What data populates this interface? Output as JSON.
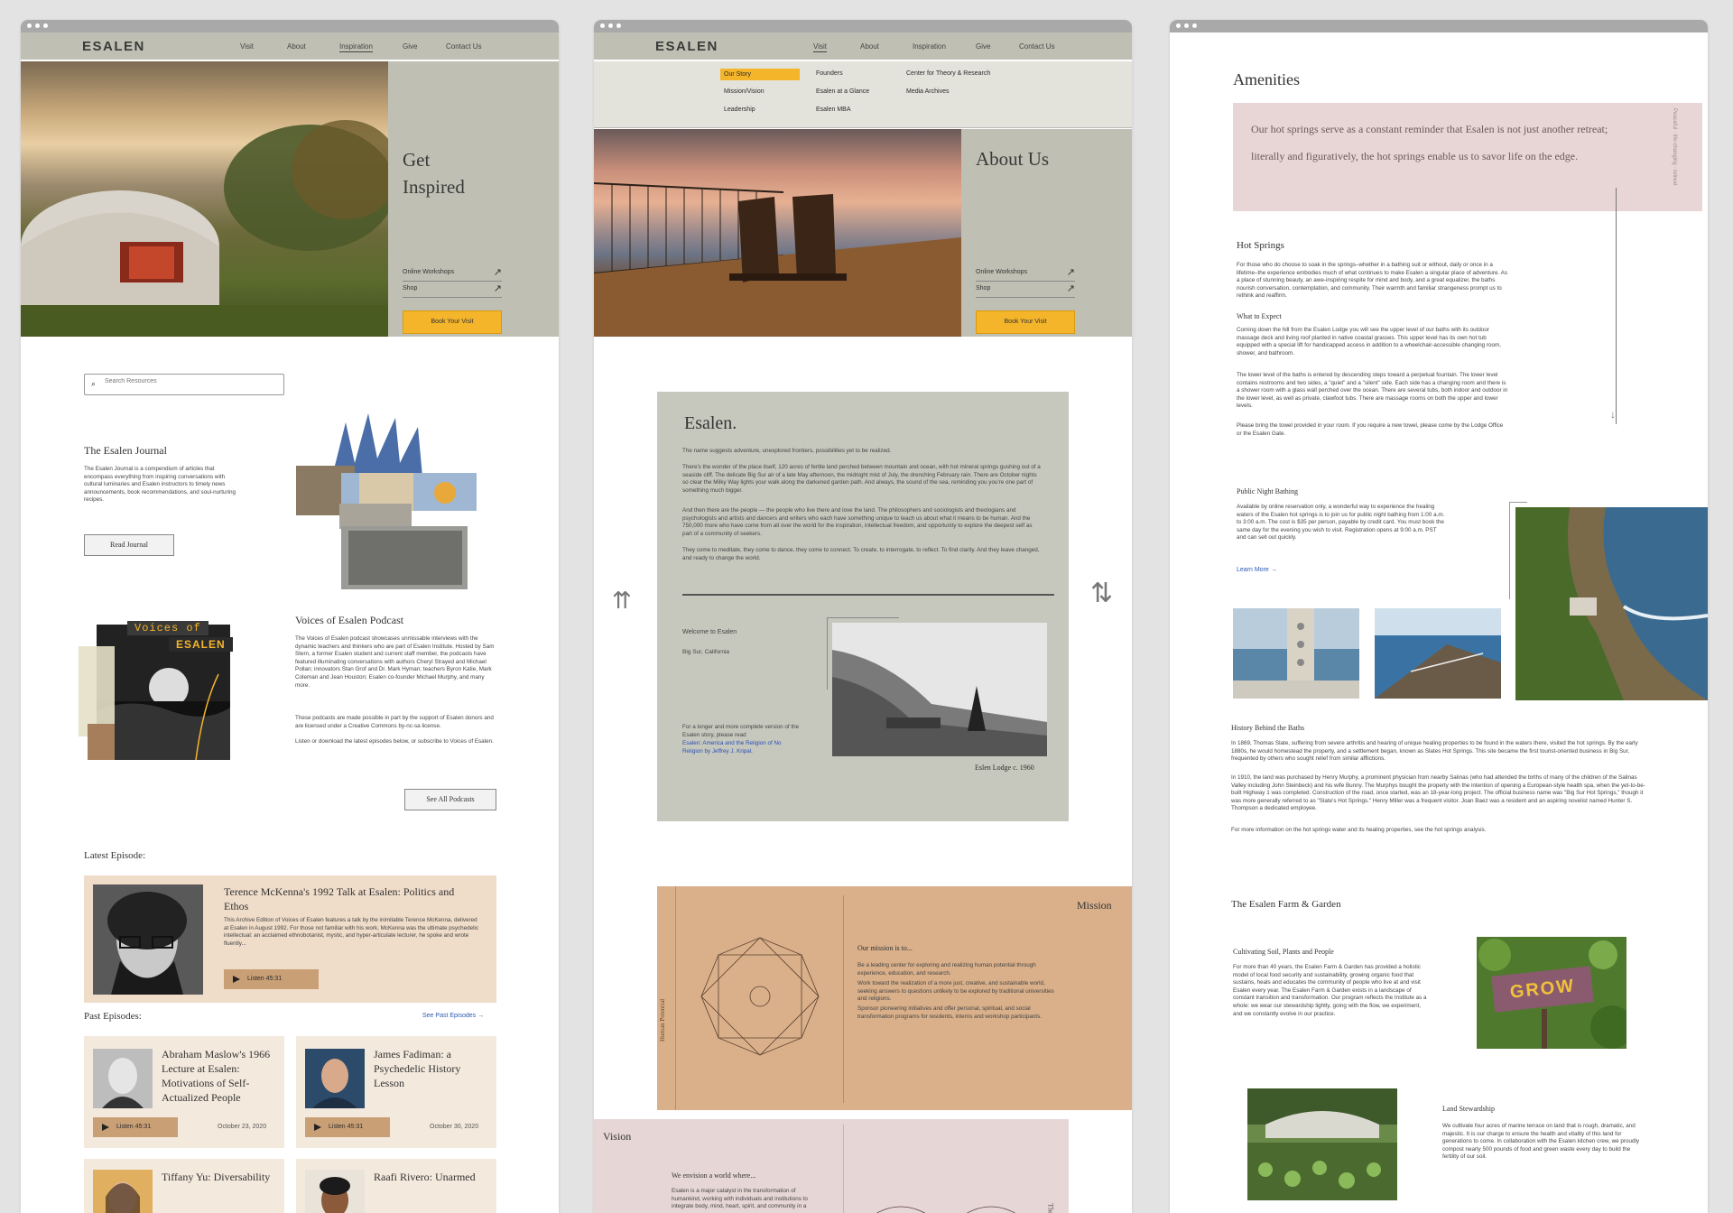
{
  "colors": {
    "background": "#e4e3e4",
    "nav_sage": "#bfc0b3",
    "accent_yellow": "#f5b52b",
    "card_cream": "#f4e9dd",
    "listen_tan": "#c99f76",
    "mission_tan": "#d9b08a",
    "vision_pink": "#e7d6d6",
    "quote_pink": "#e8d5d5"
  },
  "shared": {
    "logo": "ESALEN",
    "nav": [
      "Visit",
      "About",
      "Inspiration",
      "Give",
      "Contact Us"
    ],
    "links": [
      "Online Workshops",
      "Shop"
    ],
    "book_visit": "Book Your Visit"
  },
  "win1": {
    "hero_title_line1": "Get",
    "hero_title_line2": "Inspired",
    "search_placeholder": "Search Resources",
    "journal": {
      "title": "The Esalen Journal",
      "body": "The Esalen Journal is a compendium of articles that encompass everything from inspiring conversations with cultural luminaries and Esalen instructors to timely news announcements, book recommendations, and soul-nurturing recipes.",
      "button": "Read Journal"
    },
    "podcast": {
      "badge1": "Voices of",
      "badge2": "ESALEN",
      "title": "Voices of Esalen Podcast",
      "p1": "The Voices of Esalen podcast showcases unmissable interviews with the dynamic teachers and thinkers who are part of Esalen Institute. Hosted by Sam Stern, a former Esalen student and current staff member, the podcasts have featured illuminating conversations with authors Cheryl Strayed and Michael Pollan; innovators Stan Grof and Dr. Mark Hyman; teachers Byron Katie, Mark Coleman and Jean Houston; Esalen co-founder Michael Murphy, and many more.",
      "p2": "These podcasts are made possible in part by the support of Esalen donors and are licensed under a Creative Commons by-nc-sa license.",
      "p3": "Listen or download the latest episodes below, or subscribe to Voices of Esalen.",
      "button": "See All Podcasts"
    },
    "latest_label": "Latest Episode:",
    "latest": {
      "title": "Terence McKenna's 1992 Talk at Esalen: Politics and Ethos",
      "body": "This Archive Edition of Voices of Esalen features a talk by the inimitable Terence McKenna, delivered at Esalen in August 1992. For those not familiar with his work, McKenna was the ultimate psychedelic intellectual: an acclaimed ethnobotanist, mystic, and hyper-articulate lecturer, he spoke and wrote fluently...",
      "listen": "Listen 45:31"
    },
    "past_label": "Past Episodes:",
    "see_past": "See Past Episodes →",
    "past": [
      {
        "title": "Abraham Maslow's 1966 Lecture at Esalen: Motivations of Self-Actualized People",
        "listen": "Listen 45:31",
        "date": "October 23, 2020"
      },
      {
        "title": "James Fadiman: a Psychedelic History Lesson",
        "listen": "Listen 45:31",
        "date": "October 30, 2020"
      },
      {
        "title": "Tiffany Yu: Diversability"
      },
      {
        "title": "Raafi Rivero: Unarmed"
      }
    ]
  },
  "win2": {
    "menu": [
      "Our Story",
      "Mission/Vision",
      "Leadership",
      "Founders",
      "Esalen at a Glance",
      "Esalen MBA",
      "Center for Theory & Research",
      "Media Archives"
    ],
    "hero_title": "About Us",
    "esalen_title": "Esalen.",
    "p1": "The name suggests adventure, unexplored frontiers, possibilities yet to be realized.",
    "p2": "There's the wonder of the place itself, 120 acres of fertile land perched between mountain and ocean, with hot mineral springs gushing out of a seaside cliff. The delicate Big Sur air of a late May afternoon, the midnight mist of July, the drenching February rain. There are October nights so clear the Milky Way lights your walk along the darkened garden path. And always, the sound of the sea, reminding you you're one part of something much bigger.",
    "p3": "And then there are the people — the people who live there and love the land. The philosophers and sociologists and theologians and psychologists and artists and dancers and writers who each have something unique to teach us about what it means to be human. And the 750,000 more who have come from all over the world for the inspiration, intellectual freedom, and opportunity to explore the deepest self as part of a community of seekers.",
    "p4": "They come to meditate, they come to dance, they come to connect. To create, to interrogate, to reflect. To find clarity. And they leave changed, and ready to change the world.",
    "welcome": "Welcome to Esalen",
    "location": "Big Sur, California",
    "more": "For a longer and more complete version of the Esalen story, please read",
    "book_link": "Esalen: America and the Religion of No Religion by Jeffrey J. Kripal.",
    "caption": "Eslen Lodge c. 1960",
    "mission_label": "Mission",
    "side_label": "Human Potential",
    "mission_lead": "Our mission is to...",
    "mission_p1": "Be a leading center for exploring and realizing human potential through experience, education, and research.",
    "mission_p2": "Work toward the realization of a more just, creative, and sustainable world, seeking answers to questions unlikely to be explored by traditional universities and religions.",
    "mission_p3": "Sponsor pioneering initiatives and offer personal, spiritual, and social transformation programs for residents, interns and workshop participants.",
    "vision_label": "Vision",
    "vision_lead": "We envision a world where...",
    "vision_p": "Esalen is a major catalyst in the transformation of humankind, working with individuals and institutions to integrate body, mind, heart, spirit, and community in a",
    "vision_side": "The"
  },
  "win3": {
    "amenities": "Amenities",
    "quote": "Our hot springs serve as a constant reminder that Esalen is not just another retreat; literally and figuratively, the hot springs enable us to savor life on the edge.",
    "quote_side": "Peaceful · life-changing · retreat",
    "hs_title": "Hot Springs",
    "hs_p": "For those who do choose to soak in the springs–whether in a bathing suit or without, daily or once in a lifetime–the experience embodies much of what continues to make Esalen a singular place of adventure. As a place of stunning beauty, an awe-inspiring respite for mind and body, and a great equalizer, the baths nourish conversation, contemplation, and community. Their warmth and familiar strangeness prompt us to rethink and reaffirm.",
    "expect_title": "What to Expect",
    "expect_p1": "Coming down the hill from the Esalen Lodge you will see the upper level of our baths with its outdoor massage deck and living roof planted in native coastal grasses. This upper level has its own hot tub equipped with a special lift for handicapped access in addition to a wheelchair-accessible changing room, shower, and bathroom.",
    "expect_p2": "The lower level of the baths is entered by descending steps toward a perpetual fountain. The lower level contains restrooms and two sides, a \"quiet\" and a \"silent\" side. Each side has a changing room and there is a shower room with a glass wall perched over the ocean. There are several tubs, both indoor and outdoor in the lower level, as well as private, clawfoot tubs. There are massage rooms on both the upper and lower levels.",
    "expect_p3": "Please bring the towel provided in your room. If you require a new towel, please come by the Lodge Office or the Esalen Gate.",
    "night_title": "Public Night Bathing",
    "night_p": "Available by online reservation only, a wonderful way to experience the healing waters of the Esalen hot springs is to join us for public night bathing from 1:00 a.m. to 3:00 a.m. The cost is $35 per person, payable by credit card. You must book the same day for the evening you wish to visit. Registration opens at 9:00 a.m. PST and can sell out quickly.",
    "learn_more": "Learn More →",
    "history_title": "History Behind the Baths",
    "history_p1": "In 1869, Thomas Slate, suffering from severe arthritis and hearing of unique healing properties to be found in the waters there, visited the hot springs. By the early 1880s, he would homestead the property, and a settlement began, known as Slates Hot Springs. This site became the first tourist-oriented business in Big Sur, frequented by others who sought relief from similar afflictions.",
    "history_p2": "In 1910, the land was purchased by Henry Murphy, a prominent physician from nearby Salinas (who had attended the births of many of the children of the Salinas Valley including John Steinbeck) and his wife Bunny. The Murphys bought the property with the intention of opening a European-style health spa, when the yet-to-be-built Highway 1 was completed. Construction of the road, once started, was an 18-year-long project. The official business name was \"Big Sur Hot Springs,\" though it was more generally referred to as \"Slate's Hot Springs.\" Henry Miller was a frequent visitor. Joan Baez was a resident and an aspiring novelist named Hunter S. Thompson a dedicated employee.",
    "history_p3": "For more information on the hot springs water and its healing properties, see the hot springs analysis.",
    "farm_title": "The Esalen Farm & Garden",
    "soil_title": "Cultivating Soil, Plants and People",
    "soil_p": "For more than 40 years, the Esalen Farm & Garden has provided a holistic model of local food security and sustainability, growing organic food that sustains, heals and educates the community of people who live at and visit Esalen every year. The Esalen Farm & Garden exists in a landscape of constant transition and transformation. Our program reflects the Institute as a whole: we wear our stewardship lightly, going with the flow, we experiment, and we constantly evolve in our practice.",
    "grow_sign": "GROW",
    "land_title": "Land Stewardship",
    "land_p": "We cultivate four acres of marine terrace on land that is rough, dramatic, and majestic. It is our charge to ensure the health and vitality of this land for generations to come. In collaboration with the Esalen kitchen crew, we proudly compost nearly 500 pounds of food and green waste every day to build the fertility of our soil."
  }
}
